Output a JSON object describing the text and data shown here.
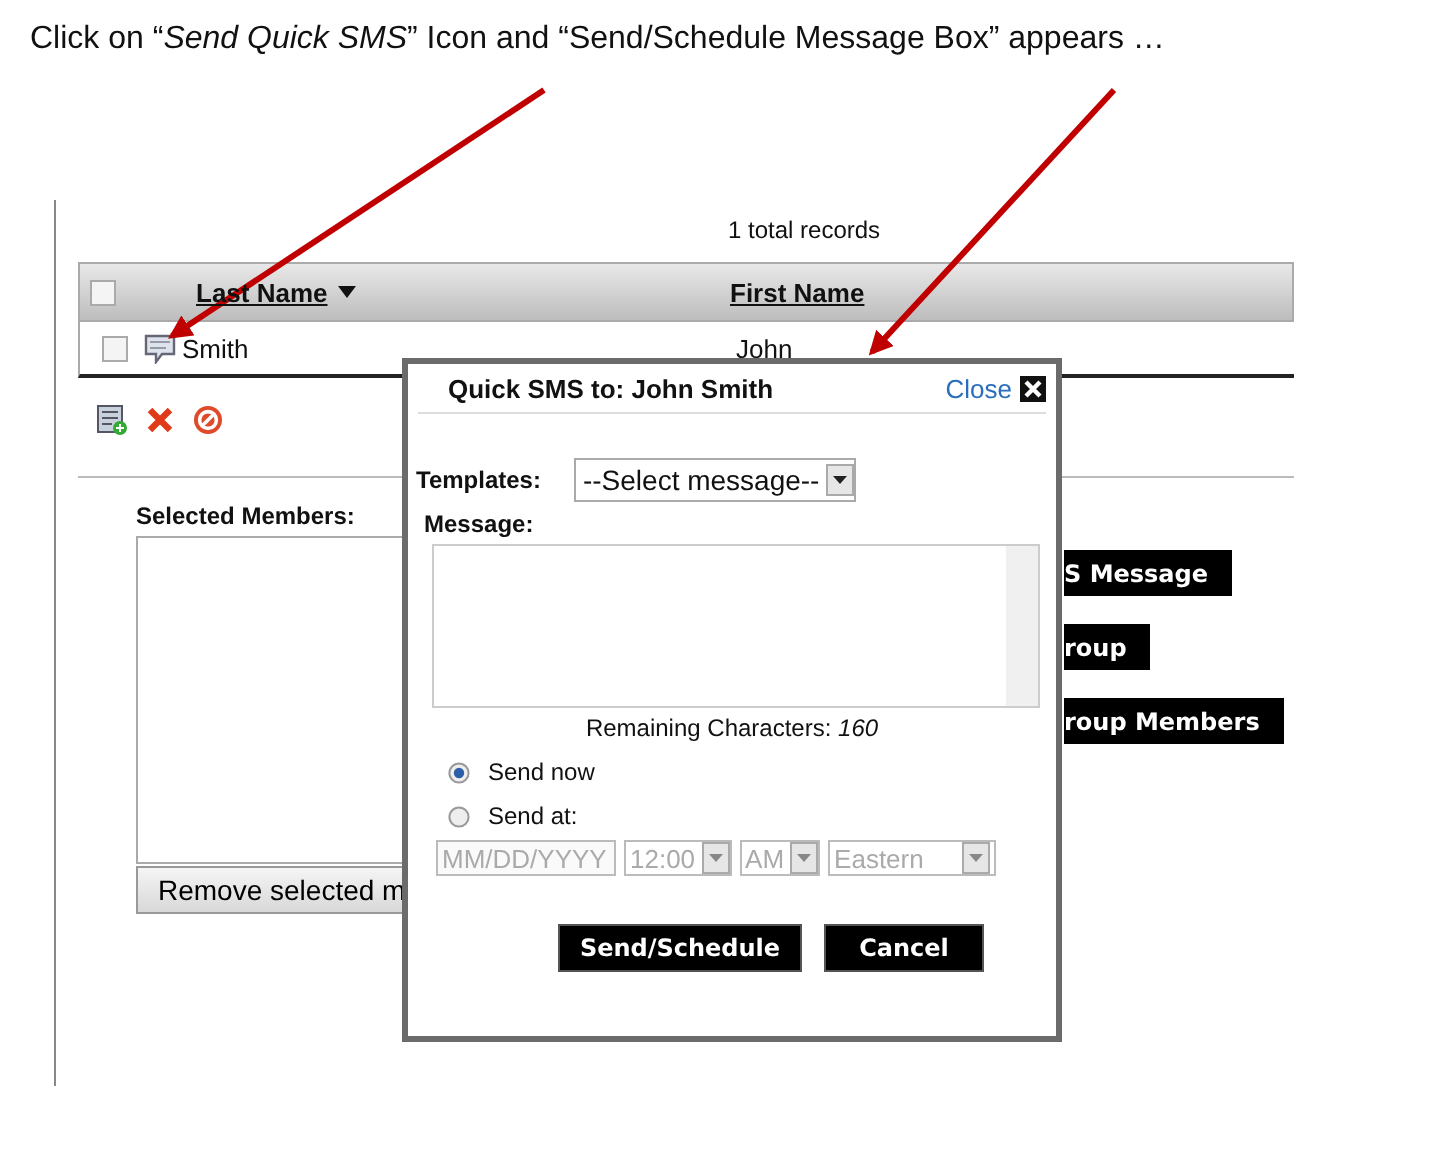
{
  "caption": "Click on “*Send Quick SMS*” Icon and “Send/Schedule Message Box” appears …",
  "records_count": "1 total records",
  "table": {
    "select_all_checked": false,
    "columns": [
      {
        "label": "Last Name",
        "sorted": true
      },
      {
        "label": "First Name",
        "sorted": false
      }
    ],
    "rows": [
      {
        "checked": false,
        "last_name": "Smith",
        "first_name": "John"
      }
    ]
  },
  "selected_members": {
    "label": "Selected Members:",
    "remove_button": "Remove selected m"
  },
  "action_buttons": [
    "S Message",
    "roup",
    "roup Members"
  ],
  "dialog": {
    "title": "Quick SMS to: John Smith",
    "close": "Close",
    "templates_label": "Templates:",
    "template_value": "--Select message--",
    "message_label": "Message:",
    "remaining": "Remaining Characters: *160*",
    "send_options": [
      {
        "label": "Send now",
        "selected": true
      },
      {
        "label": "Send at:",
        "selected": false
      }
    ],
    "schedule_disabled": true,
    "date_placeholder": "MM/DD/YYYY",
    "time": "12:00",
    "ampm": "AM",
    "timezone": "Eastern",
    "buttons": [
      "Send/Schedule",
      "Cancel"
    ]
  }
}
